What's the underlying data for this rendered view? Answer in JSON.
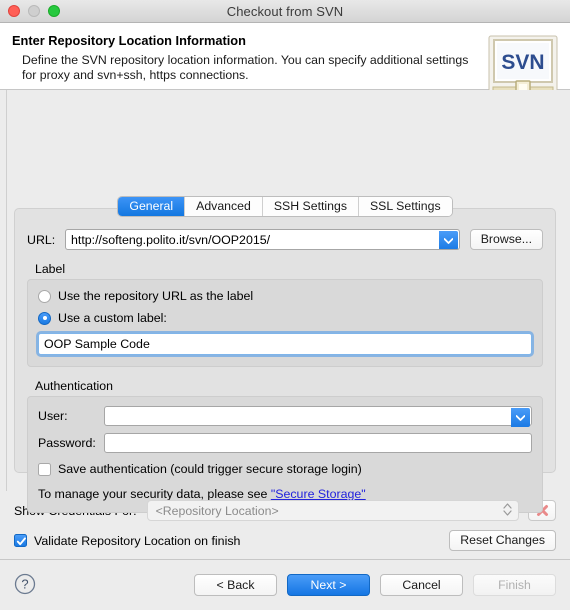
{
  "window": {
    "title": "Checkout from SVN",
    "controls": {
      "close": "close-button",
      "minimize": "minimize-button",
      "zoom": "zoom-button"
    }
  },
  "header": {
    "title": "Enter Repository Location Information",
    "description": "Define the SVN repository location information. You can specify additional settings for proxy and svn+ssh, https connections.",
    "logo_text": "SVN"
  },
  "tabs": [
    {
      "label": "General",
      "active": true
    },
    {
      "label": "Advanced",
      "active": false
    },
    {
      "label": "SSH Settings",
      "active": false
    },
    {
      "label": "SSL Settings",
      "active": false
    }
  ],
  "general": {
    "url_label": "URL:",
    "url_value": "http://softeng.polito.it/svn/OOP2015/",
    "browse_label": "Browse...",
    "label_group": {
      "title": "Label",
      "option_repo_url": "Use the repository URL as the label",
      "option_custom": "Use a custom label:",
      "selected": "custom",
      "custom_value": "OOP Sample Code"
    },
    "auth_group": {
      "title": "Authentication",
      "user_label": "User:",
      "user_value": "",
      "password_label": "Password:",
      "password_value": "",
      "save_auth_label": "Save authentication (could trigger secure storage login)",
      "save_auth_checked": false,
      "note_prefix": "To manage your security data, please see ",
      "note_link": "\"Secure Storage\""
    }
  },
  "credentials": {
    "show_for_label": "Show Credentials For:",
    "show_for_value": "<Repository Location>",
    "clear_button": "clear-credentials",
    "validate_label": "Validate Repository Location on finish",
    "validate_checked": true,
    "reset_label": "Reset Changes"
  },
  "footer": {
    "help": "?",
    "back_label": "< Back",
    "next_label": "Next >",
    "cancel_label": "Cancel",
    "finish_label": "Finish",
    "finish_disabled": true
  },
  "colors": {
    "accent": "#1a7ae4",
    "link": "#2222dd",
    "panel_bg": "#e2e2e2",
    "group_bg": "#d9d9d9"
  }
}
